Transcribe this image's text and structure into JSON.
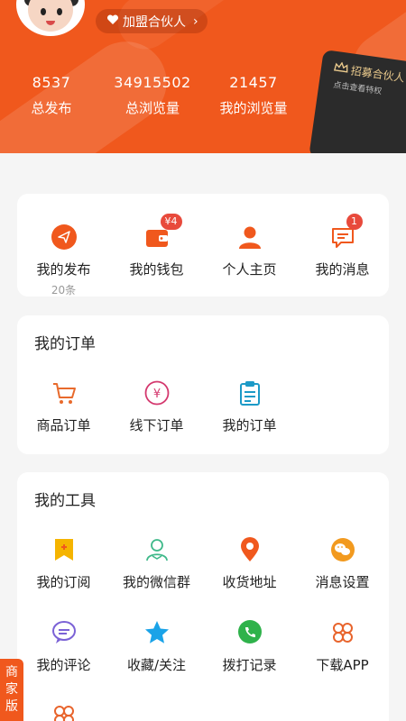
{
  "header": {
    "partner_pill_label": "加盟合伙人",
    "stats": [
      {
        "value": "8537",
        "label": "总发布"
      },
      {
        "value": "34915502",
        "label": "总浏览量"
      },
      {
        "value": "21457",
        "label": "我的浏览量"
      }
    ],
    "recruit_card": {
      "title": "招募合伙人",
      "subtitle": "点击查看特权"
    }
  },
  "quick": [
    {
      "label": "我的发布",
      "sub": "20条"
    },
    {
      "label": "我的钱包",
      "badge": "¥4"
    },
    {
      "label": "个人主页"
    },
    {
      "label": "我的消息",
      "badge": "1"
    }
  ],
  "orders": {
    "title": "我的订单",
    "items": [
      {
        "label": "商品订单"
      },
      {
        "label": "线下订单"
      },
      {
        "label": "我的订单"
      }
    ]
  },
  "tools": {
    "title": "我的工具",
    "items": [
      {
        "label": "我的订阅"
      },
      {
        "label": "我的微信群"
      },
      {
        "label": "收货地址"
      },
      {
        "label": "消息设置"
      },
      {
        "label": "我的评论"
      },
      {
        "label": "收藏/关注"
      },
      {
        "label": "拨打记录"
      },
      {
        "label": "下载APP"
      }
    ]
  },
  "merchant_tab": {
    "label": "商家版"
  },
  "colors": {
    "brand": "#f0581d",
    "badge": "#e84a3c"
  }
}
